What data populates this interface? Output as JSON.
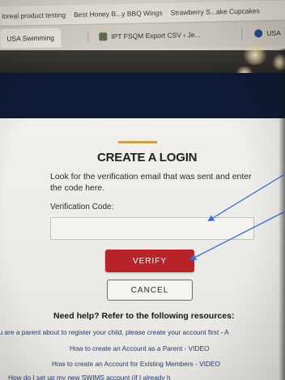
{
  "browser": {
    "bookmarks": [
      "loreal product testing",
      "Best Honey B...y BBQ Wings",
      "Strawberry S...ake Cupcakes"
    ],
    "tabs": [
      {
        "label": "USA Swimming",
        "icon": "usa-swimming-icon"
      },
      {
        "label": "IPT FSQM Export CSV ‹ Je...",
        "icon": "csv-file-icon"
      },
      {
        "label": "USA",
        "icon": "usa-swimming-icon"
      }
    ]
  },
  "login": {
    "title": "CREATE A LOGIN",
    "instructions": "Look for the verification email that was sent and enter the code here.",
    "code_label": "Verification Code:",
    "code_value": "",
    "verify_label": "VERIFY",
    "cancel_label": "CANCEL"
  },
  "help": {
    "title": "Need help? Refer to the following resources:",
    "links": [
      "ou are a parent about to register your child, please create your account first - A",
      "How to create an Account as a Parent - VIDEO",
      "How to create an Account for Existing Members - VIDEO",
      "How do I set up my new SWIMS account (if I already h"
    ]
  },
  "colors": {
    "accent_red": "#b8232a",
    "gold": "#c8a34a",
    "navy": "#0f1a35",
    "annotation_arrow": "#3d6fd8"
  }
}
